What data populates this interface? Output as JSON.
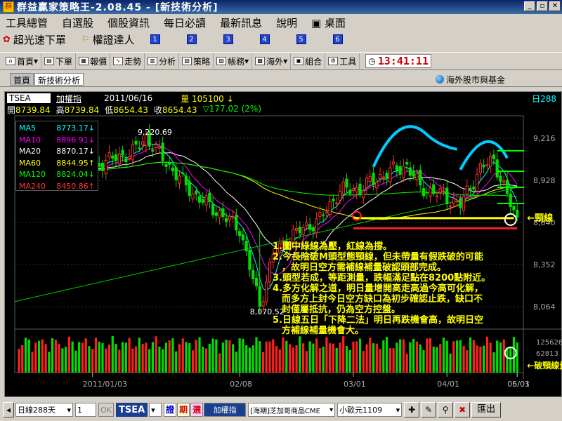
{
  "window": {
    "title": "群益贏家策略王-2.08.45 - [新技術分析]"
  },
  "menu": {
    "items": [
      "工具總管",
      "自選股",
      "個股資訊",
      "每日必讀",
      "最新訊息",
      "說明",
      "桌面"
    ]
  },
  "quickbar": {
    "items": [
      "超光速下單",
      "權證達人"
    ],
    "numbers": [
      "1",
      "2",
      "3",
      "4",
      "5",
      "6"
    ]
  },
  "toolbar": {
    "items": [
      "首頁",
      "下單",
      "報價",
      "走勢",
      "分析",
      "策略",
      "帳務",
      "海外",
      "組合",
      "工具"
    ],
    "time": "13:41:11"
  },
  "tabs": {
    "items": [
      "首頁",
      "新技術分析"
    ],
    "right": "海外股市與基金"
  },
  "header": {
    "symbol": "TSEA",
    "index_name": "加權指",
    "date": "2011/06/16",
    "volume": "量 105100 ↓",
    "days": "日288",
    "open_label": "開",
    "open": "8739.84",
    "high_label": "高",
    "high": "8739.84",
    "low_label": "低",
    "low": "8654.43",
    "close_label": "收",
    "close": "8654.43",
    "change": "▽177.02 (2%)"
  },
  "legend": [
    {
      "name": "MA5",
      "value": "8773.17↓",
      "color": "#00ffff"
    },
    {
      "name": "MA10",
      "value": "8896.91↓",
      "color": "#ff00ff"
    },
    {
      "name": "MA20",
      "value": "8870.17↓",
      "color": "#ffffff"
    },
    {
      "name": "MA60",
      "value": "8844.95↑",
      "color": "#ffff00"
    },
    {
      "name": "MA120",
      "value": "8824.04↓",
      "color": "#00ff00"
    },
    {
      "name": "MA240",
      "value": "8450.86↑",
      "color": "#ff3333"
    }
  ],
  "annotations": [
    "1.圖中綠線為壓，紅線為撐。",
    "2.今長陰破M頭型態頸線，但未帶量有假跌破的可能",
    "　，故明日空方需補線補量破認頭部完成。",
    "3.頭型若成，等距測量，跌幅滿足點在8200點附近。",
    "4.多方化解之道，明日量增開高走高過今高可化解，",
    "　而多方上封今日空方缺口為初步確認止跌，缺口不",
    "　封僅屬抵抗，仍為空方控盤。",
    "5.日線五日「下降二法」明日再跌機會高，故明日空",
    "　方補線補量機會大。"
  ],
  "chart_labels": {
    "neckline": "頸線",
    "vol_note": "←破頸線量縮",
    "peak": "9,220.69",
    "trough": "8,070.52"
  },
  "chart_data": {
    "type": "candlestick",
    "ylim": [
      7950,
      9350
    ],
    "yticks": [
      9216,
      8928,
      8640,
      8352,
      8064
    ],
    "vol_ticks": [
      62813,
      125626
    ],
    "xticks": [
      "2011/01/03",
      "02/08",
      "03/01",
      "04/01",
      "05/03",
      "06/01"
    ],
    "peak": 9220.69,
    "trough": 8070.52
  },
  "bottom": {
    "period": "日線288天",
    "count": "1",
    "ok": "OK",
    "symbol": "TSEA",
    "b1": "證",
    "b2": "期",
    "b3": "選",
    "name": "加權指",
    "fut": "[海期]芝加哥商品CME",
    "fut2": "小歐元1109",
    "exit": "匯出"
  }
}
